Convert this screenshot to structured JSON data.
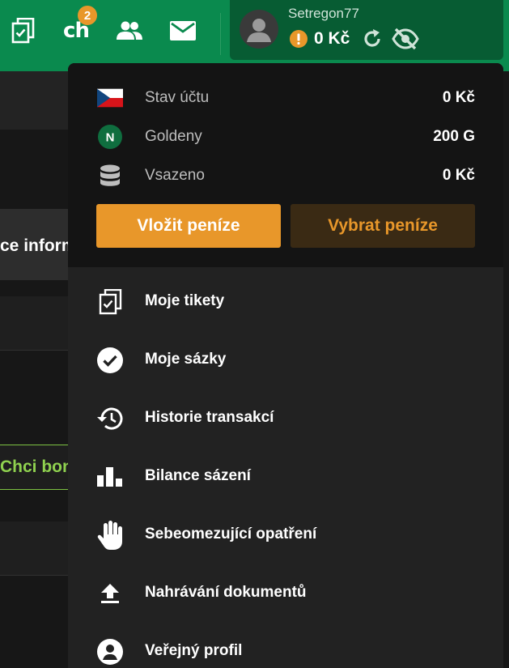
{
  "topbar": {
    "chat_label": "ch",
    "chat_badge": "2"
  },
  "account": {
    "username": "Setregon77",
    "balance": "0 Kč"
  },
  "background": {
    "info_text": "ce inform",
    "cta_text": "Chci bon"
  },
  "wallet": {
    "rows": [
      {
        "icon": "czech-flag-icon",
        "label": "Stav účtu",
        "value": "0 Kč"
      },
      {
        "icon": "goldeny-coin-icon",
        "label": "Goldeny",
        "value": "200 G",
        "coin_letter": "N"
      },
      {
        "icon": "coin-stack-icon",
        "label": "Vsazeno",
        "value": "0 Kč"
      }
    ],
    "deposit_label": "Vložit peníze",
    "withdraw_label": "Vybrat peníze"
  },
  "menu": [
    {
      "icon": "tickets-icon",
      "label": "Moje tikety"
    },
    {
      "icon": "check-circle-icon",
      "label": "Moje sázky"
    },
    {
      "icon": "history-icon",
      "label": "Historie transakcí"
    },
    {
      "icon": "bar-chart-icon",
      "label": "Bilance sázení"
    },
    {
      "icon": "hand-icon",
      "label": "Sebeomezující opatření"
    },
    {
      "icon": "upload-icon",
      "label": "Nahrávání dokumentů"
    },
    {
      "icon": "profile-icon",
      "label": "Veřejný profil"
    }
  ],
  "colors": {
    "brand_green": "#0a8a4e",
    "account_green": "#075c33",
    "accent_orange": "#e8972a",
    "cta_green": "#8fd14f"
  }
}
